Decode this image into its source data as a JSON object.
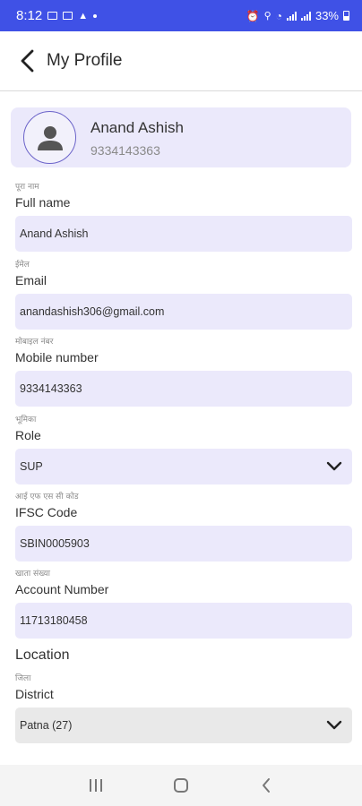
{
  "status_bar": {
    "time": "8:12",
    "battery": "33%"
  },
  "header": {
    "title": "My Profile"
  },
  "profile": {
    "name": "Anand Ashish",
    "phone": "9334143363"
  },
  "fields": {
    "full_name": {
      "label_hi": "पूरा नाम",
      "label_en": "Full name",
      "value": "Anand Ashish"
    },
    "email": {
      "label_hi": "ईमेल",
      "label_en": "Email",
      "value": "anandashish306@gmail.com"
    },
    "mobile": {
      "label_hi": "मोबाइल नंबर",
      "label_en": "Mobile number",
      "value": "9334143363"
    },
    "role": {
      "label_hi": "भूमिका",
      "label_en": "Role",
      "value": "SUP"
    },
    "ifsc": {
      "label_hi": "आई एफ एस सी कोड",
      "label_en": "IFSC Code",
      "value": "SBIN0005903"
    },
    "account": {
      "label_hi": "खाता संख्या",
      "label_en": "Account Number",
      "value": "11713180458"
    },
    "district": {
      "label_hi": "जिला",
      "label_en": "District",
      "value": "Patna (27)"
    }
  },
  "location_section": {
    "title": "Location"
  },
  "colors": {
    "status_bar": "#3f51e6",
    "field_bg": "#ebe9fb",
    "disabled_field_bg": "#e9e9e9"
  }
}
